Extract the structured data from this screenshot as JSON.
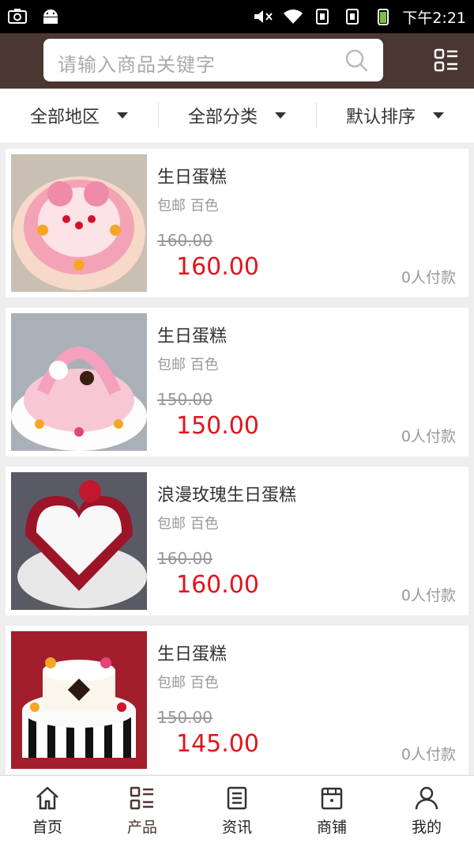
{
  "status_bar": {
    "time": "下午2:21"
  },
  "search": {
    "placeholder": "请输入商品关键字"
  },
  "filters": [
    {
      "label": "全部地区"
    },
    {
      "label": "全部分类"
    },
    {
      "label": "默认排序"
    }
  ],
  "products": [
    {
      "title": "生日蛋糕",
      "tags": "包邮 百色",
      "original_price": "160.00",
      "price": "160.00",
      "sales": "0人付款"
    },
    {
      "title": "生日蛋糕",
      "tags": "包邮 百色",
      "original_price": "150.00",
      "price": "150.00",
      "sales": "0人付款"
    },
    {
      "title": "浪漫玫瑰生日蛋糕",
      "tags": "包邮 百色",
      "original_price": "160.00",
      "price": "160.00",
      "sales": "0人付款"
    },
    {
      "title": "生日蛋糕",
      "tags": "包邮 百色",
      "original_price": "150.00",
      "price": "145.00",
      "sales": "0人付款"
    }
  ],
  "tabbar": [
    {
      "label": "首页",
      "icon": "home-icon"
    },
    {
      "label": "产品",
      "icon": "product-grid-icon",
      "active": true
    },
    {
      "label": "资讯",
      "icon": "news-icon"
    },
    {
      "label": "商铺",
      "icon": "store-icon"
    },
    {
      "label": "我的",
      "icon": "user-icon"
    }
  ],
  "colors": {
    "header": "#4a3731",
    "price": "#e0151b"
  }
}
